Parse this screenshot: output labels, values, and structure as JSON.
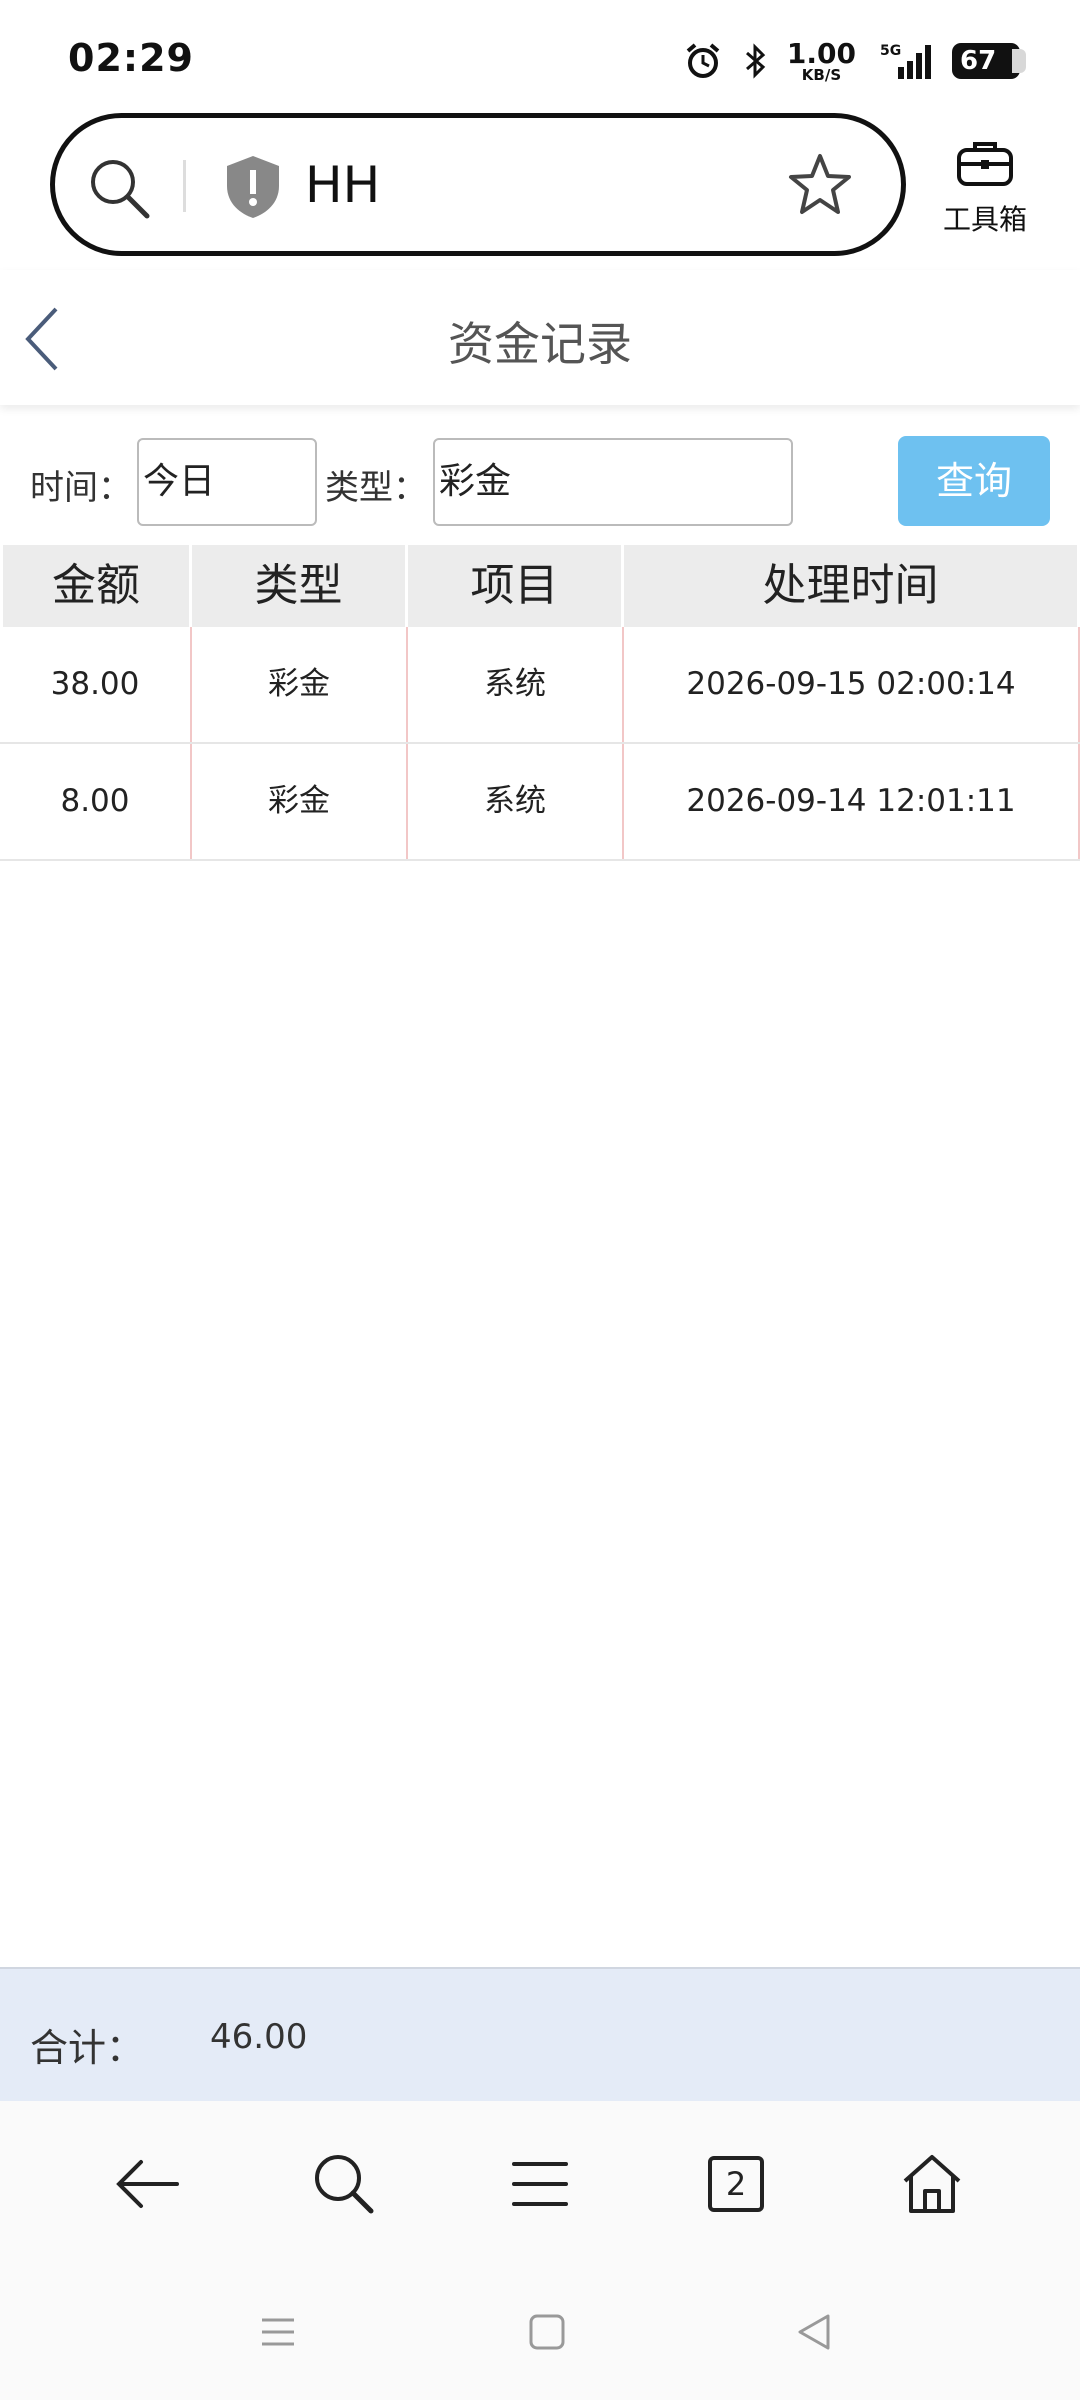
{
  "status_bar": {
    "time": "02:29",
    "net_speed_value": "1.00",
    "net_speed_unit": "KB/S",
    "network": "5G",
    "battery": "67"
  },
  "browser": {
    "url_text": "HH",
    "toolbox_label": "工具箱"
  },
  "page": {
    "title": "资金记录"
  },
  "filter": {
    "time_label": "时间：",
    "time_value": "今日",
    "type_label": "类型：",
    "type_value": "彩金",
    "query_button": "查询"
  },
  "table": {
    "headers": [
      "金额",
      "类型",
      "项目",
      "处理时间"
    ],
    "rows": [
      [
        "38.00",
        "彩金",
        "系统",
        "2026-09-15 02:00:14"
      ],
      [
        "8.00",
        "彩金",
        "系统",
        "2026-09-14 12:01:11"
      ]
    ]
  },
  "total": {
    "label": "合计：",
    "value": "46.00"
  },
  "bottom_nav": {
    "tab_count": "2"
  }
}
